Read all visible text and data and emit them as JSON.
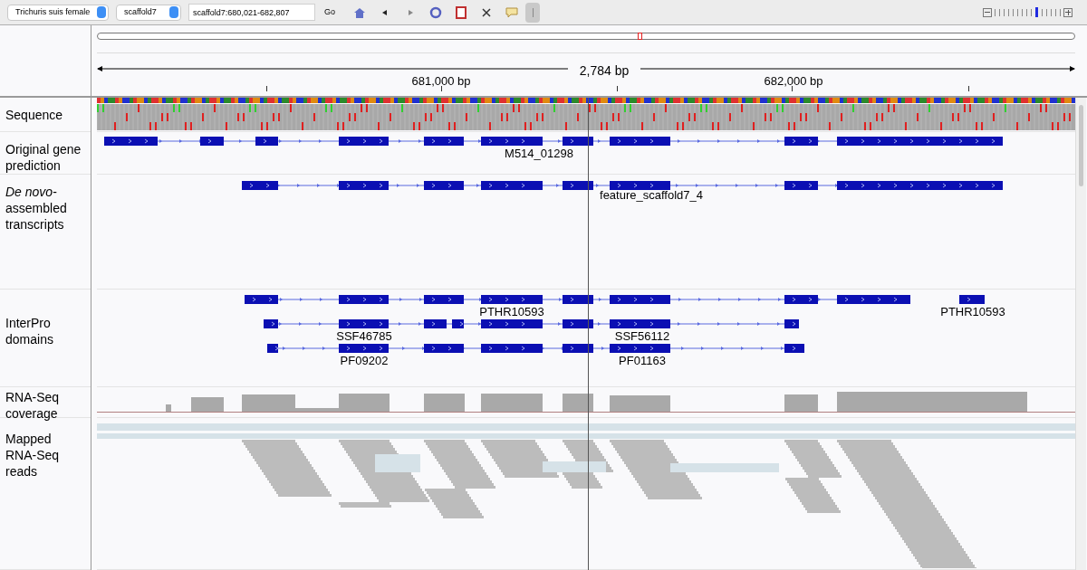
{
  "toolbar": {
    "genome": "Trichuris suis female",
    "chromosome": "scaffold7",
    "locus": "scaffold7:680,021-682,807",
    "go": "Go"
  },
  "zoom": {
    "level": 0.64
  },
  "ruler": {
    "span": "2,784 bp",
    "ticks": [
      "681,000 bp",
      "682,000 bp"
    ]
  },
  "tracks": [
    {
      "kind": "sequence",
      "name": "Sequence"
    },
    {
      "kind": "gene",
      "name": "Original gene prediction",
      "features": [
        {
          "label": "M514_01298"
        }
      ]
    },
    {
      "kind": "gene",
      "name": "*De novo*-assembled transcripts",
      "features": [
        {
          "label": "feature_scaffold7_4"
        }
      ]
    },
    {
      "kind": "domains",
      "name": "InterPro domains",
      "features": [
        {
          "label": "PTHR10593"
        },
        {
          "label": "PTHR10593"
        },
        {
          "label": "SSF46785"
        },
        {
          "label": "SSF56112"
        },
        {
          "label": "PF09202"
        },
        {
          "label": "PF01163"
        }
      ]
    },
    {
      "kind": "coverage",
      "name": "RNA-Seq coverage"
    },
    {
      "kind": "reads",
      "name": "Mapped RNA-Seq reads"
    }
  ]
}
